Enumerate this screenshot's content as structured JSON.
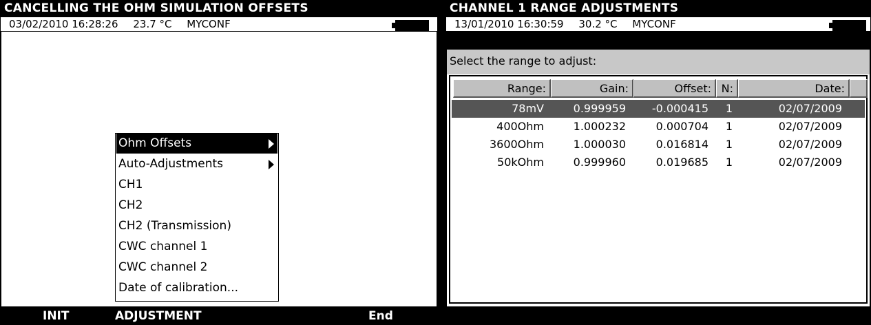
{
  "left_screen": {
    "title": "CANCELLING THE OHM SIMULATION OFFSETS",
    "status": {
      "datetime": "03/02/2010 16:28:26",
      "temperature": "23.7 °C",
      "config": "MYCONF"
    },
    "menu": [
      {
        "label": "Ohm Offsets",
        "submenu": true,
        "selected": true
      },
      {
        "label": "Auto-Adjustments",
        "submenu": true,
        "selected": false
      },
      {
        "label": "CH1",
        "submenu": false,
        "selected": false
      },
      {
        "label": "CH2",
        "submenu": false,
        "selected": false
      },
      {
        "label": "CH2 (Transmission)",
        "submenu": false,
        "selected": false
      },
      {
        "label": "CWC channel 1",
        "submenu": false,
        "selected": false
      },
      {
        "label": "CWC channel 2",
        "submenu": false,
        "selected": false
      },
      {
        "label": "Date of calibration...",
        "submenu": false,
        "selected": false
      }
    ],
    "footer": {
      "key1": "INIT",
      "key2": "ADJUSTMENT",
      "key3": "End"
    }
  },
  "right_screen": {
    "title": "CHANNEL 1 RANGE ADJUSTMENTS",
    "status": {
      "datetime": "13/01/2010 16:30:59",
      "temperature": "30.2 °C",
      "config": "MYCONF"
    },
    "prompt": "Select the range to adjust:",
    "table": {
      "headers": [
        "Range:",
        "Gain:",
        "Offset:",
        "N:",
        "Date:"
      ],
      "rows": [
        [
          "78mV",
          "0.999959",
          "-0.000415",
          "1",
          "02/07/2009"
        ],
        [
          "400Ohm",
          "1.000232",
          "0.000704",
          "1",
          "02/07/2009"
        ],
        [
          "3600Ohm",
          "1.000030",
          "0.016814",
          "1",
          "02/07/2009"
        ],
        [
          "50kOhm",
          "0.999960",
          "0.019685",
          "1",
          "02/07/2009"
        ]
      ],
      "selected_row": 0
    }
  },
  "icons": {
    "battery": "battery-icon",
    "submenu_arrow": "submenu-arrow-icon"
  },
  "colors": {
    "screen_bg": "#ffffff",
    "title_bar": "#000000",
    "selection": "#000000",
    "table_selection": "#555555",
    "header_cell": "#c0c0c0",
    "prompt_bar": "#c8c8c8"
  }
}
